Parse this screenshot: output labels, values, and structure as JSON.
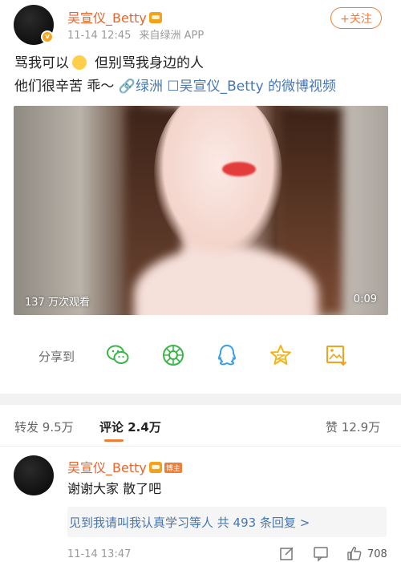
{
  "post": {
    "author": "吴宣仪_Betty",
    "verified_badge": "v",
    "time": "11-14 12:45",
    "source": "来自绿洲 APP",
    "follow_label": "+关注",
    "line1_a": "骂我可以",
    "line1_b": "但别骂我身边的人",
    "line2_text": "他们很辛苦 乖～",
    "link_oasis": "🔗绿洲",
    "link_video": "☐吴宣仪_Betty 的微博视频"
  },
  "video": {
    "views": "137 万次观看",
    "duration": "0:09"
  },
  "share": {
    "label": "分享到",
    "icons": [
      "wechat-icon",
      "moments-icon",
      "qq-icon",
      "qzone-icon",
      "album-icon"
    ],
    "colors": {
      "wechat": "#3bb54a",
      "moments": "#3bb54a",
      "qq": "#3a9ee6",
      "qzone": "#f2b416",
      "album": "#f2a319"
    }
  },
  "stats": {
    "repost_label": "转发",
    "repost_count": "9.5万",
    "comment_label": "评论",
    "comment_count": "2.4万",
    "like_label": "赞",
    "like_count": "12.9万"
  },
  "comment": {
    "author": "吴宣仪_Betty",
    "host_tag": "博主",
    "text": "谢谢大家 散了吧",
    "reply_summary": "见到我请叫我认真学习等人 共 493 条回复 >",
    "time": "11-14 13:47",
    "like_count": "708"
  },
  "colors": {
    "accent": "#f07c37",
    "username": "#e8642a",
    "link": "#4677b4"
  }
}
